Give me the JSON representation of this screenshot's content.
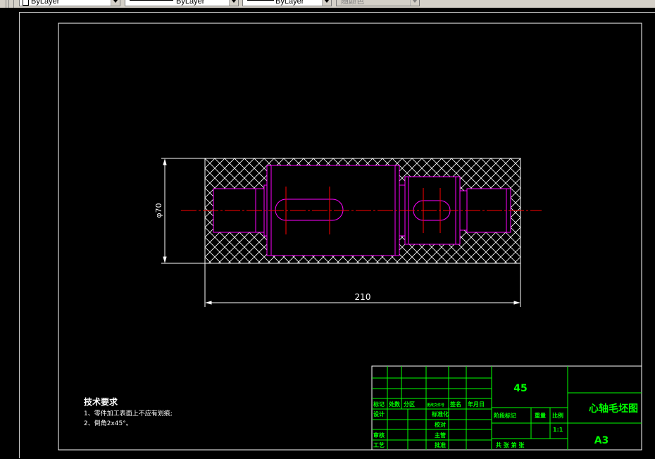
{
  "toolbar": {
    "color_value": "ByLayer",
    "linetype_value": "ByLayer",
    "lineweight_value": "ByLayer",
    "plotstyle_value": "随颜色"
  },
  "drawing": {
    "dimension_diameter": "φ70",
    "dimension_length": "210",
    "tech_req_title": "技术要求",
    "tech_req_items": [
      "1、零件加工表面上不应有划痕;",
      "2、倒角2x45°。"
    ],
    "title_block": {
      "material": "45",
      "part_name": "心轴毛坯图",
      "drawing_no": "A3",
      "labels": {
        "biaoji": "标记",
        "chushu": "处数",
        "fenqu": "分区",
        "gengai": "更改文件号",
        "qianming": "签名",
        "nianyueri": "年月日",
        "sheji": "设计",
        "biaozhunhua": "标准化",
        "shenhe": "审核",
        "gongyi": "工艺",
        "pizhun": "批准",
        "jieduan": "阶段标记",
        "zhongliang": "重量",
        "bili": "比例",
        "scale_value": "1:1",
        "gong_zhang_di_zhang": "共  张  第  张",
        "jiaoyi": "校对",
        "zhupi": "主管"
      },
      "colors": {
        "frame": "#ffffff",
        "text": "#00ff00",
        "table_lines": "#00ff00",
        "part_outline": "#ff00ff",
        "centerline": "#ff0000",
        "hatch": "#ffffff"
      }
    }
  }
}
